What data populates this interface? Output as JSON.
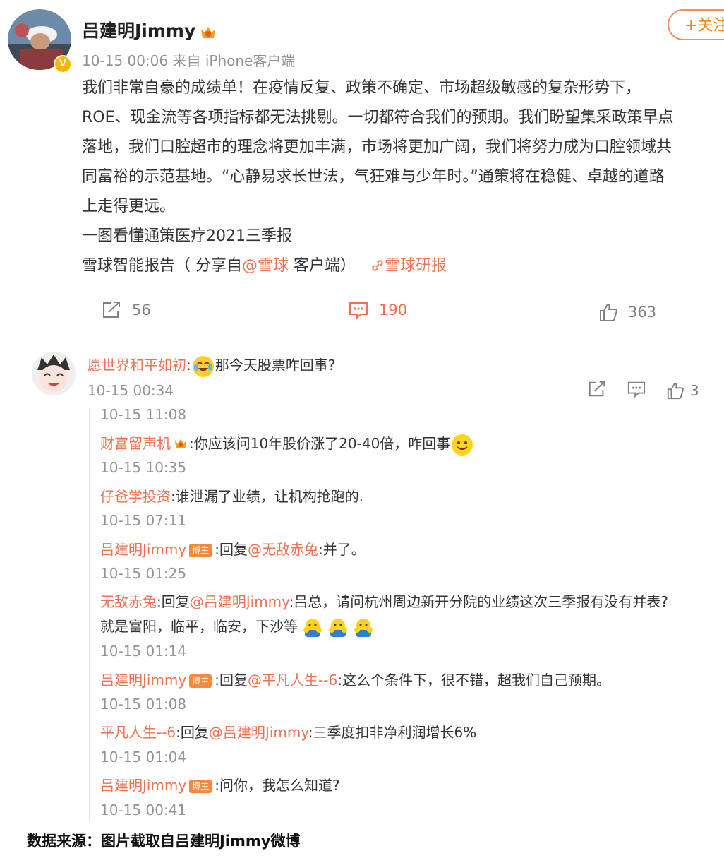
{
  "post": {
    "author": "吕建明Jimmy",
    "meta": "10-15 00:06 来自 iPhone客户端",
    "follow_label": "+关注",
    "lines": [
      "我们非常自豪的成绩单！在疫情反复、政策不确定、市场超级敏感的复杂形势下，",
      "ROE、现金流等各项指标都无法挑剔。一切都符合我们的预期。我们盼望集采政策早点",
      "落地，我们口腔超市的理念将更加丰满，市场将更加广阔，我们将努力成为口腔领域共",
      "同富裕的示范基地。“心静易求长世法，气狂难与少年时。”通策将在稳健、卓越的道路",
      "上走得更远。",
      "一图看懂通策医疗2021三季报"
    ],
    "share_prefix": "雪球智能报告（ 分享自",
    "share_mention": "@雪球",
    "share_suffix": " 客户端）",
    "share_link": "雪球研报",
    "repost_count": "56",
    "comment_count": "190",
    "like_count": "363"
  },
  "comment": {
    "user": "愿世界和平如初",
    "text": "那今天股票咋回事?",
    "time": "10-15 00:34",
    "like_count": "3"
  },
  "replies": [
    {
      "type": "time",
      "text": "10-15 11:08"
    },
    {
      "type": "reply",
      "user": "财富留声机",
      "text": ":你应该问10年股价涨了20-40倍，咋回事"
    },
    {
      "type": "time",
      "text": "10-15 10:35"
    },
    {
      "type": "reply",
      "user": "仔爸学投资",
      "text": ":谁泄漏了业绩，让机构抢跑的."
    },
    {
      "type": "time",
      "text": "10-15 07:11"
    },
    {
      "type": "reply",
      "user": "吕建明Jimmy",
      "badge": "博主",
      "pre": ":回复",
      "mention": "@无敌赤兔",
      "text": ":并了。"
    },
    {
      "type": "time",
      "text": "10-15 01:25"
    },
    {
      "type": "reply",
      "user": "无敌赤兔",
      "pre": ":回复",
      "mention": "@吕建明Jimmy",
      "text": ":吕总，请问杭州周边新开分院的业绩这次三季报有没有并表?"
    },
    {
      "type": "text",
      "text": "就是富阳，临平，临安，下沙等"
    },
    {
      "type": "time",
      "text": "10-15 01:14"
    },
    {
      "type": "reply",
      "user": "吕建明Jimmy",
      "badge": "博主",
      "pre": ":回复",
      "mention": "@平凡人生--6",
      "text": ":这么个条件下，很不错，超我们自己预期。"
    },
    {
      "type": "time",
      "text": "10-15 01:08"
    },
    {
      "type": "reply",
      "user": "平凡人生--6",
      "pre": ":回复",
      "mention": "@吕建明Jimmy",
      "text": ":三季度扣非净利润增长6%"
    },
    {
      "type": "time",
      "text": "10-15 01:04"
    },
    {
      "type": "reply",
      "user": "吕建明Jimmy",
      "badge": "博主",
      "text": ":问你，我怎么知道?"
    },
    {
      "type": "time",
      "text": "10-15 00:41"
    }
  ],
  "footer": "数据来源：图片截取自吕建明Jimmy微博",
  "colors": {
    "link": "#eb7350",
    "follow": "#ff8200",
    "badge": "#f7893a",
    "verified": "#f7b500"
  }
}
